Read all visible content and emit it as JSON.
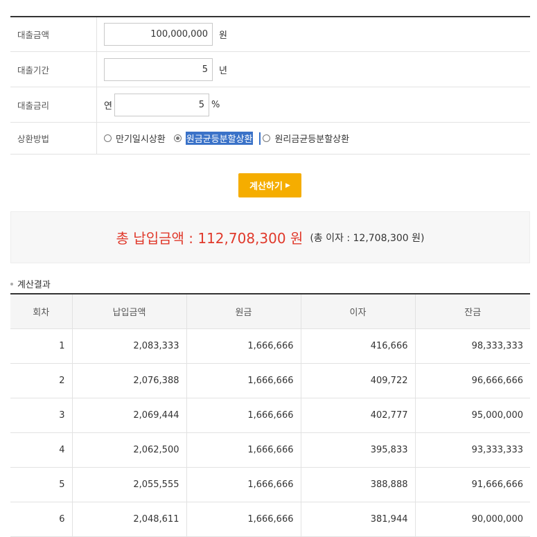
{
  "form": {
    "amount_label": "대출금액",
    "amount_value": "100,000,000",
    "amount_unit": "원",
    "period_label": "대출기간",
    "period_value": "5",
    "period_unit": "년",
    "rate_label": "대출금리",
    "rate_prefix": "연",
    "rate_value": "5",
    "rate_unit": "%",
    "method_label": "상환방법",
    "method_options": [
      "만기일시상환",
      "원금균등분할상환",
      "원리금균등분할상환"
    ],
    "method_selected": "원금균등분할상환"
  },
  "calc_button": "계산하기",
  "summary": {
    "total_label": "총 납입금액 : 112,708,300 원",
    "interest_label": "(총 이자 :  12,708,300 원)"
  },
  "result_title": "계산결과",
  "table": {
    "headers": [
      "회차",
      "납입금액",
      "원금",
      "이자",
      "잔금"
    ],
    "rows": [
      [
        "1",
        "2,083,333",
        "1,666,666",
        "416,666",
        "98,333,333"
      ],
      [
        "2",
        "2,076,388",
        "1,666,666",
        "409,722",
        "96,666,666"
      ],
      [
        "3",
        "2,069,444",
        "1,666,666",
        "402,777",
        "95,000,000"
      ],
      [
        "4",
        "2,062,500",
        "1,666,666",
        "395,833",
        "93,333,333"
      ],
      [
        "5",
        "2,055,555",
        "1,666,666",
        "388,888",
        "91,666,666"
      ],
      [
        "6",
        "2,048,611",
        "1,666,666",
        "381,944",
        "90,000,000"
      ]
    ]
  },
  "colors": {
    "accent_button": "#f5ad00",
    "total_text": "#e0392b",
    "selection": "#3a72c8"
  }
}
